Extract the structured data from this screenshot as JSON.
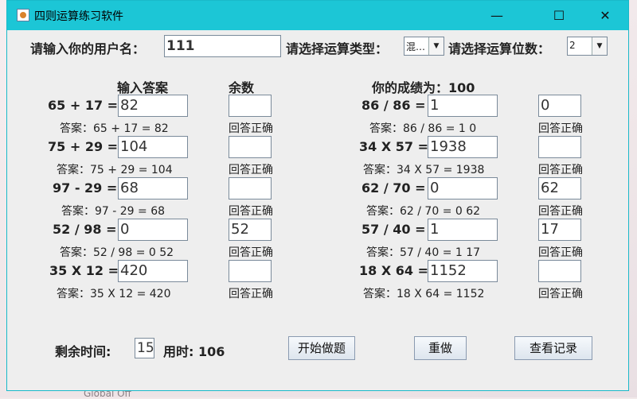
{
  "window": {
    "title": "四则运算练习软件",
    "minimize_glyph": "—",
    "maximize_glyph": "☐",
    "close_glyph": "✕",
    "icon": "java-app-icon"
  },
  "header": {
    "username_label": "请输入你的用户名：",
    "username_value": "111",
    "op_type_label": "请选择运算类型：",
    "op_type_value": "混…",
    "digits_label": "请选择运算位数：",
    "digits_value": "2"
  },
  "columns": {
    "answer_header": "输入答案",
    "remainder_header": "余数",
    "score_label": "你的成绩为：100"
  },
  "left_questions": [
    {
      "expr": "65 + 17 =",
      "answer": "82",
      "remainder": "",
      "solution": "答案：65 + 17 = 82",
      "result": "回答正确"
    },
    {
      "expr": "75 + 29 =",
      "answer": "104",
      "remainder": "",
      "solution": "答案：75 + 29 = 104",
      "result": "回答正确"
    },
    {
      "expr": "97 - 29 =",
      "answer": "68",
      "remainder": "",
      "solution": "答案：97 - 29 = 68",
      "result": "回答正确"
    },
    {
      "expr": "52 / 98 =",
      "answer": "0",
      "remainder": "52",
      "solution": "答案：52 / 98 = 0 52",
      "result": "回答正确"
    },
    {
      "expr": "35 X 12 =",
      "answer": "420",
      "remainder": "",
      "solution": "答案：35 X 12 = 420",
      "result": "回答正确"
    }
  ],
  "right_questions": [
    {
      "expr": "86 / 86 =",
      "answer": "1",
      "remainder": "0",
      "solution": "答案：86 / 86 = 1 0",
      "result": "回答正确"
    },
    {
      "expr": "34 X 57 =",
      "answer": "1938",
      "remainder": "",
      "solution": "答案：34 X 57 = 1938",
      "result": "回答正确"
    },
    {
      "expr": "62 / 70 =",
      "answer": "0",
      "remainder": "62",
      "solution": "答案：62 / 70 = 0 62",
      "result": "回答正确"
    },
    {
      "expr": "57 / 40 =",
      "answer": "1",
      "remainder": "17",
      "solution": "答案：57 / 40 = 1 17",
      "result": "回答正确"
    },
    {
      "expr": "18 X 64 =",
      "answer": "1152",
      "remainder": "",
      "solution": "答案：18 X 64 = 1152",
      "result": "回答正确"
    }
  ],
  "footer": {
    "remaining_label": "剩余时间:",
    "remaining_value": "15",
    "elapsed_label": "用时:  106",
    "start_button": "开始做题",
    "redo_button": "重做",
    "records_button": "查看记录"
  },
  "desktop": {
    "background_text": "Global Off"
  },
  "colors": {
    "titlebar": "#1cc6d6",
    "window_bg": "#eeeeee"
  }
}
